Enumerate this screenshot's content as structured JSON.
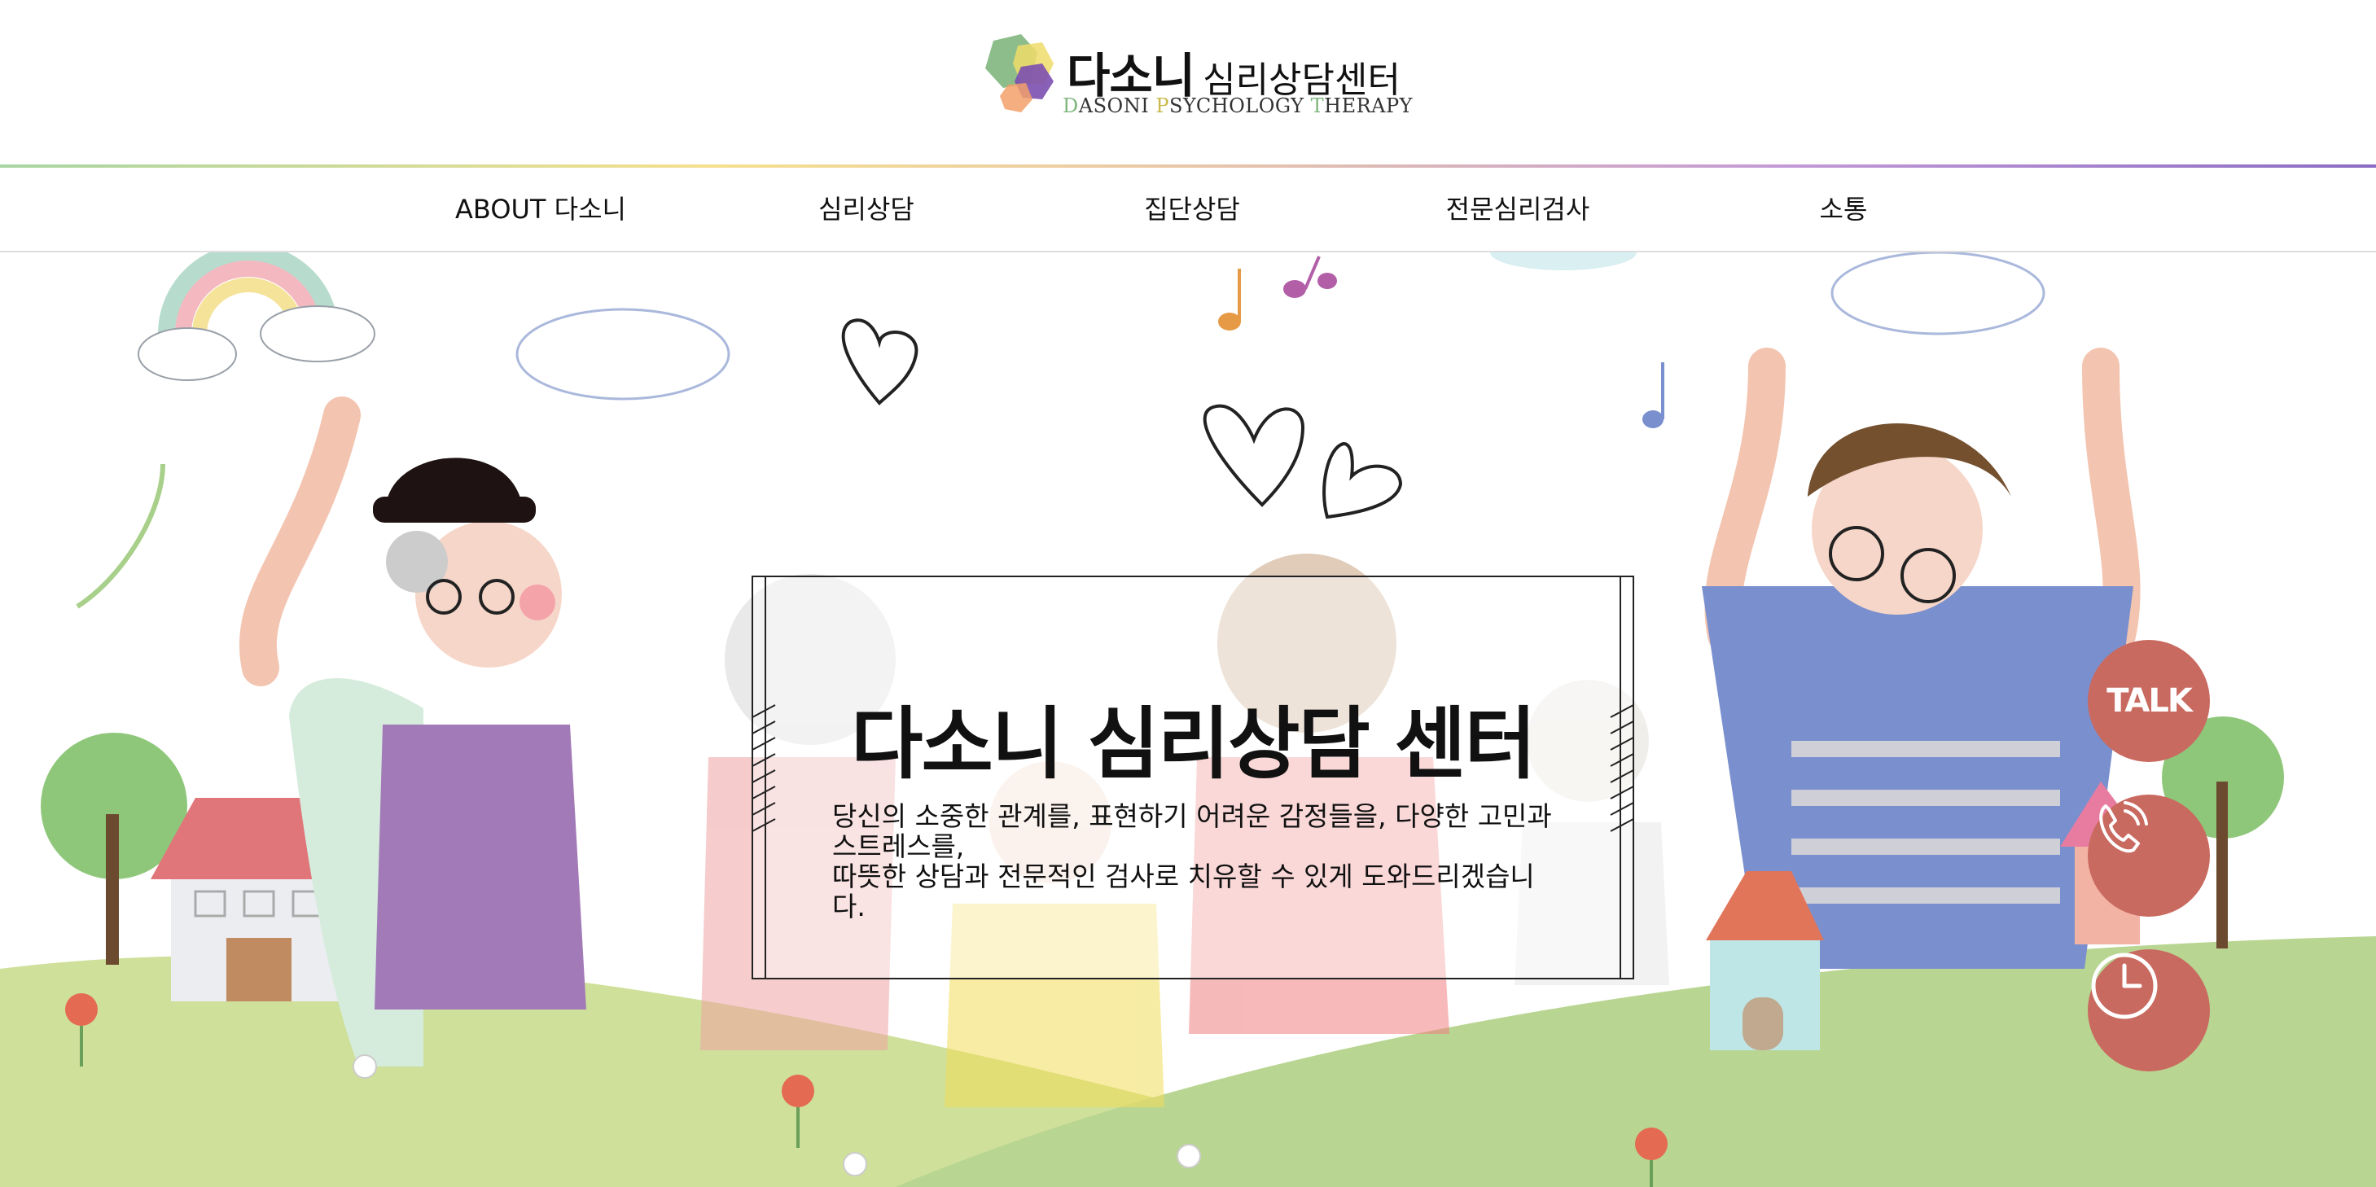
{
  "header": {
    "logo_title": "다소니",
    "logo_title_suffix": "심리상담센터",
    "logo_sub_d": "D",
    "logo_sub_1": "ASONI ",
    "logo_sub_p": "P",
    "logo_sub_2": "SYCHOLOGY ",
    "logo_sub_t": "T",
    "logo_sub_3": "HERAPY"
  },
  "nav": {
    "items": [
      {
        "label": "ABOUT 다소니"
      },
      {
        "label": "심리상담"
      },
      {
        "label": "집단상담"
      },
      {
        "label": "전문심리검사"
      },
      {
        "label": "소통"
      }
    ]
  },
  "hero": {
    "title": "다소니 심리상담 센터",
    "desc_line1": "당신의 소중한 관계를, 표현하기 어려운 감정들을, 다양한 고민과 스트레스를,",
    "desc_line2": "따뜻한 상담과 전문적인 검사로 치유할 수 있게 도와드리겠습니다."
  },
  "floating": {
    "talk_label": "TALK",
    "icons": [
      "talk-icon",
      "phone-icon",
      "clock-icon"
    ]
  },
  "colors": {
    "accent": "#c96a60",
    "grass_light": "#cfe09a",
    "grass_dark": "#b9d592"
  }
}
